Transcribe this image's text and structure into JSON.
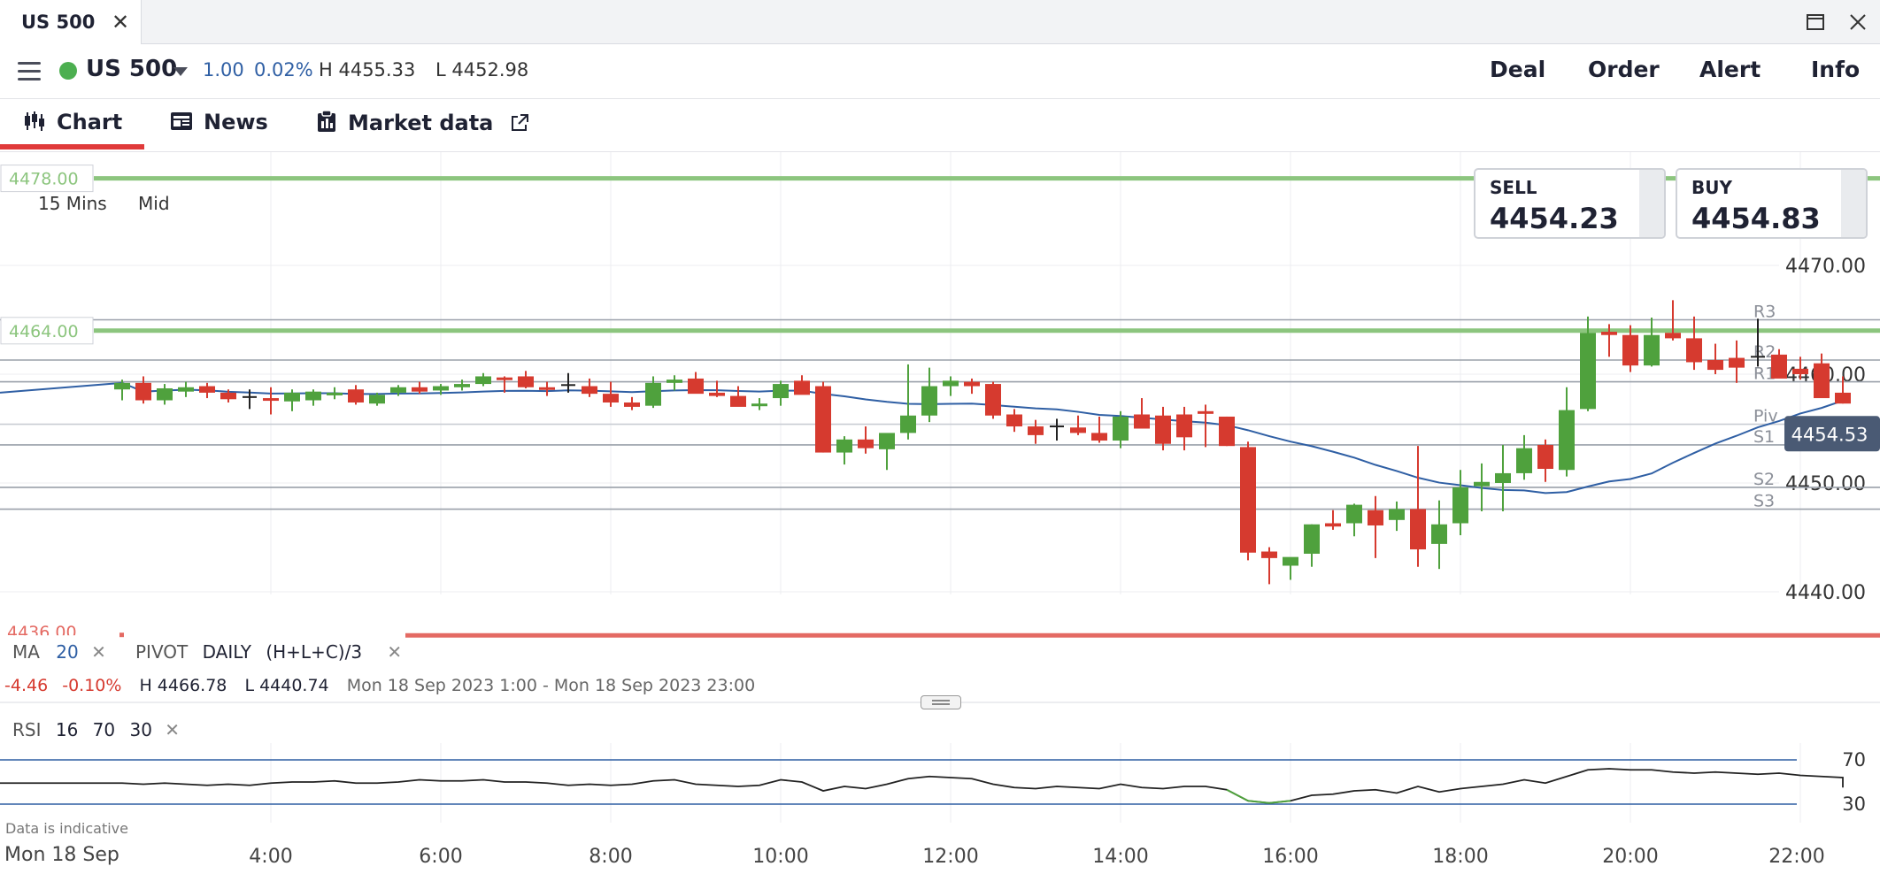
{
  "window": {
    "tab_title": "US 500",
    "close_icon": "close-icon",
    "maximize_icon": "maximize-icon"
  },
  "header": {
    "menu_icon": "hamburger-menu-icon",
    "status_color": "#4caf50",
    "instrument": "US 500",
    "change_points": "1.00",
    "change_pct": "0.02%",
    "high": "H 4455.33",
    "low": "L 4452.98",
    "actions": [
      "Deal",
      "Order",
      "Alert",
      "Info"
    ]
  },
  "subnav": {
    "tabs": [
      {
        "label": "Chart",
        "icon": "candlestick-icon",
        "active": true
      },
      {
        "label": "News",
        "icon": "newspaper-icon"
      },
      {
        "label": "Market data",
        "icon": "clipboard-icon",
        "external_icon": "external-link-icon"
      }
    ]
  },
  "quote": {
    "sell_label": "SELL",
    "sell_price": "4454.23",
    "buy_label": "BUY",
    "buy_price": "4454.83"
  },
  "timeframe": {
    "interval": "15 Mins",
    "price_type": "Mid"
  },
  "levels": {
    "alert_upper": "4478.00",
    "alert_mid": "4464.00",
    "alert_lower": "4436.00",
    "pivot_labels": [
      "R3",
      "R2",
      "R1",
      "Piv",
      "S1",
      "S2",
      "S3"
    ],
    "current_price_tag": "4454.53"
  },
  "indicators": {
    "ma_label": "MA",
    "ma_period": "20",
    "pivot_label": "PIVOT",
    "pivot_period": "DAILY",
    "pivot_formula": "(H+L+C)/3",
    "change_abs": "-4.46",
    "change_pct": "-0.10%",
    "session_high": "H 4466.78",
    "session_low": "L 4440.74",
    "session_range": "Mon 18 Sep 2023 1:00 - Mon 18 Sep 2023 23:00",
    "rsi_label": "RSI",
    "rsi_period": "16",
    "rsi_upper": "70",
    "rsi_lower": "30"
  },
  "footer": {
    "disclaimer": "Data is indicative",
    "date_label": "Mon 18 Sep"
  },
  "colors": {
    "up": "#4fa13d",
    "down": "#d63a2f",
    "accent_blue": "#2f5fa4",
    "alert_green": "#8cc57e",
    "alert_red": "#e46a63",
    "tag_bg": "#4a5a74"
  },
  "chart_data": {
    "type": "candlestick",
    "interval": "15 Mins",
    "y_range": [
      4436,
      4479
    ],
    "y_ticks": [
      "4470.00",
      "4460.00",
      "4450.00",
      "4440.00"
    ],
    "x_ticks": [
      "4:00",
      "6:00",
      "8:00",
      "10:00",
      "12:00",
      "14:00",
      "16:00",
      "18:00",
      "20:00",
      "22:00"
    ],
    "pivot_levels": {
      "R3": 4465.0,
      "R2": 4461.3,
      "R1": 4459.3,
      "Piv": 4455.4,
      "S1": 4453.5,
      "S2": 4449.6,
      "S3": 4447.6
    },
    "alert_lines": [
      4478.0,
      4464.0,
      4436.0
    ],
    "candles": [
      {
        "t": "2:15",
        "o": 4458.6,
        "h": 4459.5,
        "l": 4457.6,
        "c": 4459.2
      },
      {
        "t": "2:30",
        "o": 4459.2,
        "h": 4459.8,
        "l": 4457.3,
        "c": 4457.6
      },
      {
        "t": "2:45",
        "o": 4457.6,
        "h": 4459.1,
        "l": 4457.2,
        "c": 4458.7
      },
      {
        "t": "3:00",
        "o": 4458.4,
        "h": 4459.3,
        "l": 4457.9,
        "c": 4458.8
      },
      {
        "t": "3:15",
        "o": 4458.9,
        "h": 4459.2,
        "l": 4457.8,
        "c": 4458.3
      },
      {
        "t": "3:30",
        "o": 4458.3,
        "h": 4458.6,
        "l": 4457.4,
        "c": 4457.7
      },
      {
        "t": "3:45",
        "o": 4457.9,
        "h": 4458.6,
        "l": 4456.8,
        "c": 4457.9
      },
      {
        "t": "4:00",
        "o": 4457.8,
        "h": 4458.8,
        "l": 4456.3,
        "c": 4457.6
      },
      {
        "t": "4:15",
        "o": 4457.5,
        "h": 4458.6,
        "l": 4456.6,
        "c": 4458.3
      },
      {
        "t": "4:30",
        "o": 4457.6,
        "h": 4458.6,
        "l": 4457.1,
        "c": 4458.4
      },
      {
        "t": "4:45",
        "o": 4458.1,
        "h": 4458.8,
        "l": 4457.7,
        "c": 4458.3
      },
      {
        "t": "5:00",
        "o": 4458.6,
        "h": 4459.0,
        "l": 4457.2,
        "c": 4457.4
      },
      {
        "t": "5:15",
        "o": 4457.3,
        "h": 4458.3,
        "l": 4457.1,
        "c": 4458.1
      },
      {
        "t": "5:30",
        "o": 4458.3,
        "h": 4459.0,
        "l": 4458.0,
        "c": 4458.8
      },
      {
        "t": "5:45",
        "o": 4458.8,
        "h": 4459.3,
        "l": 4458.2,
        "c": 4458.4
      },
      {
        "t": "6:00",
        "o": 4458.5,
        "h": 4459.1,
        "l": 4458.1,
        "c": 4458.9
      },
      {
        "t": "6:15",
        "o": 4458.8,
        "h": 4459.5,
        "l": 4458.5,
        "c": 4459.1
      },
      {
        "t": "6:30",
        "o": 4459.1,
        "h": 4460.1,
        "l": 4458.9,
        "c": 4459.8
      },
      {
        "t": "6:45",
        "o": 4459.7,
        "h": 4459.8,
        "l": 4458.3,
        "c": 4459.5
      },
      {
        "t": "7:00",
        "o": 4459.8,
        "h": 4460.3,
        "l": 4458.7,
        "c": 4458.8
      },
      {
        "t": "7:15",
        "o": 4458.8,
        "h": 4459.3,
        "l": 4458.0,
        "c": 4458.6
      },
      {
        "t": "7:30",
        "o": 4459.0,
        "h": 4460.1,
        "l": 4458.3,
        "c": 4458.9
      },
      {
        "t": "7:45",
        "o": 4458.9,
        "h": 4459.6,
        "l": 4457.9,
        "c": 4458.2
      },
      {
        "t": "8:00",
        "o": 4458.2,
        "h": 4459.3,
        "l": 4457.0,
        "c": 4457.4
      },
      {
        "t": "8:15",
        "o": 4457.4,
        "h": 4457.9,
        "l": 4456.7,
        "c": 4457.0
      },
      {
        "t": "8:30",
        "o": 4457.1,
        "h": 4459.8,
        "l": 4456.9,
        "c": 4459.2
      },
      {
        "t": "8:45",
        "o": 4459.2,
        "h": 4459.9,
        "l": 4458.5,
        "c": 4459.5
      },
      {
        "t": "9:00",
        "o": 4459.6,
        "h": 4460.2,
        "l": 4458.6,
        "c": 4458.2
      },
      {
        "t": "9:15",
        "o": 4458.3,
        "h": 4459.4,
        "l": 4457.9,
        "c": 4458.0
      },
      {
        "t": "9:30",
        "o": 4458.0,
        "h": 4458.9,
        "l": 4457.6,
        "c": 4457.0
      },
      {
        "t": "9:45",
        "o": 4457.1,
        "h": 4457.8,
        "l": 4456.7,
        "c": 4457.3
      },
      {
        "t": "10:00",
        "o": 4457.8,
        "h": 4459.4,
        "l": 4457.1,
        "c": 4459.1
      },
      {
        "t": "10:15",
        "o": 4459.4,
        "h": 4459.9,
        "l": 4458.3,
        "c": 4458.1
      },
      {
        "t": "10:30",
        "o": 4458.9,
        "h": 4459.3,
        "l": 4452.8,
        "c": 4452.8
      },
      {
        "t": "10:45",
        "o": 4452.8,
        "h": 4454.3,
        "l": 4451.7,
        "c": 4454.0
      },
      {
        "t": "11:00",
        "o": 4454.0,
        "h": 4455.2,
        "l": 4452.7,
        "c": 4453.2
      },
      {
        "t": "11:15",
        "o": 4453.1,
        "h": 4454.5,
        "l": 4451.2,
        "c": 4454.6
      },
      {
        "t": "11:30",
        "o": 4454.6,
        "h": 4460.9,
        "l": 4454.0,
        "c": 4456.2
      },
      {
        "t": "11:45",
        "o": 4456.2,
        "h": 4460.6,
        "l": 4455.6,
        "c": 4458.9
      },
      {
        "t": "12:00",
        "o": 4458.9,
        "h": 4459.8,
        "l": 4458.0,
        "c": 4459.4
      },
      {
        "t": "12:15",
        "o": 4459.3,
        "h": 4459.6,
        "l": 4458.2,
        "c": 4458.9
      },
      {
        "t": "12:30",
        "o": 4459.1,
        "h": 4459.3,
        "l": 4455.9,
        "c": 4456.2
      },
      {
        "t": "12:45",
        "o": 4456.3,
        "h": 4456.8,
        "l": 4454.7,
        "c": 4455.2
      },
      {
        "t": "13:00",
        "o": 4455.2,
        "h": 4455.8,
        "l": 4453.6,
        "c": 4454.4
      },
      {
        "t": "13:15",
        "o": 4455.1,
        "h": 4455.9,
        "l": 4453.9,
        "c": 4455.2
      },
      {
        "t": "13:30",
        "o": 4455.1,
        "h": 4456.2,
        "l": 4454.4,
        "c": 4454.6
      },
      {
        "t": "13:45",
        "o": 4454.6,
        "h": 4456.1,
        "l": 4453.7,
        "c": 4453.9
      },
      {
        "t": "14:00",
        "o": 4453.9,
        "h": 4456.6,
        "l": 4453.2,
        "c": 4456.1
      },
      {
        "t": "14:15",
        "o": 4456.3,
        "h": 4457.8,
        "l": 4455.5,
        "c": 4455.0
      },
      {
        "t": "14:30",
        "o": 4456.2,
        "h": 4457.0,
        "l": 4453.0,
        "c": 4453.6
      },
      {
        "t": "14:45",
        "o": 4456.3,
        "h": 4457.0,
        "l": 4453.0,
        "c": 4454.2
      },
      {
        "t": "15:00",
        "o": 4456.6,
        "h": 4457.2,
        "l": 4453.3,
        "c": 4456.4
      },
      {
        "t": "15:15",
        "o": 4456.1,
        "h": 4456.1,
        "l": 4453.4,
        "c": 4453.4
      },
      {
        "t": "15:30",
        "o": 4453.3,
        "h": 4453.8,
        "l": 4442.9,
        "c": 4443.6
      },
      {
        "t": "15:45",
        "o": 4443.7,
        "h": 4444.1,
        "l": 4440.7,
        "c": 4443.1
      },
      {
        "t": "16:00",
        "o": 4442.4,
        "h": 4443.1,
        "l": 4441.1,
        "c": 4443.2
      },
      {
        "t": "16:15",
        "o": 4443.5,
        "h": 4446.2,
        "l": 4442.3,
        "c": 4446.2
      },
      {
        "t": "16:30",
        "o": 4446.3,
        "h": 4447.5,
        "l": 4445.7,
        "c": 4446.0
      },
      {
        "t": "16:45",
        "o": 4446.3,
        "h": 4448.1,
        "l": 4445.1,
        "c": 4448.0
      },
      {
        "t": "17:00",
        "o": 4447.5,
        "h": 4448.8,
        "l": 4443.1,
        "c": 4446.1
      },
      {
        "t": "17:15",
        "o": 4446.6,
        "h": 4448.3,
        "l": 4445.6,
        "c": 4447.6
      },
      {
        "t": "17:30",
        "o": 4447.6,
        "h": 4453.4,
        "l": 4442.3,
        "c": 4443.9
      },
      {
        "t": "17:45",
        "o": 4444.4,
        "h": 4448.4,
        "l": 4442.1,
        "c": 4446.2
      },
      {
        "t": "18:00",
        "o": 4446.3,
        "h": 4451.2,
        "l": 4445.2,
        "c": 4449.6
      },
      {
        "t": "18:15",
        "o": 4449.7,
        "h": 4451.8,
        "l": 4447.4,
        "c": 4450.1
      },
      {
        "t": "18:30",
        "o": 4450.0,
        "h": 4453.5,
        "l": 4447.4,
        "c": 4450.9
      },
      {
        "t": "18:45",
        "o": 4450.9,
        "h": 4454.4,
        "l": 4450.3,
        "c": 4453.2
      },
      {
        "t": "19:00",
        "o": 4453.5,
        "h": 4454.0,
        "l": 4450.1,
        "c": 4451.3
      },
      {
        "t": "19:15",
        "o": 4451.2,
        "h": 4458.8,
        "l": 4450.6,
        "c": 4456.7
      },
      {
        "t": "19:30",
        "o": 4456.8,
        "h": 4465.3,
        "l": 4456.6,
        "c": 4463.8
      },
      {
        "t": "19:45",
        "o": 4463.9,
        "h": 4464.6,
        "l": 4461.6,
        "c": 4463.6
      },
      {
        "t": "20:00",
        "o": 4463.6,
        "h": 4464.5,
        "l": 4460.2,
        "c": 4460.8
      },
      {
        "t": "20:15",
        "o": 4460.8,
        "h": 4465.2,
        "l": 4460.7,
        "c": 4463.6
      },
      {
        "t": "20:30",
        "o": 4463.8,
        "h": 4466.8,
        "l": 4463.1,
        "c": 4463.3
      },
      {
        "t": "20:45",
        "o": 4463.3,
        "h": 4465.3,
        "l": 4460.4,
        "c": 4461.1
      },
      {
        "t": "21:00",
        "o": 4461.3,
        "h": 4462.8,
        "l": 4460.0,
        "c": 4460.4
      },
      {
        "t": "21:15",
        "o": 4461.5,
        "h": 4463.1,
        "l": 4459.2,
        "c": 4460.6
      },
      {
        "t": "21:30",
        "o": 4461.6,
        "h": 4465.1,
        "l": 4460.7,
        "c": 4461.5
      },
      {
        "t": "21:45",
        "o": 4461.8,
        "h": 4462.3,
        "l": 4459.9,
        "c": 4459.6
      },
      {
        "t": "22:00",
        "o": 4460.5,
        "h": 4461.6,
        "l": 4459.5,
        "c": 4460.0
      },
      {
        "t": "22:15",
        "o": 4461.0,
        "h": 4461.9,
        "l": 4458.9,
        "c": 4457.8
      },
      {
        "t": "22:30",
        "o": 4458.3,
        "h": 4459.8,
        "l": 4457.3,
        "c": 4457.3
      }
    ],
    "rsi": [
      49,
      48,
      49,
      48,
      47,
      48,
      47,
      49,
      50,
      50,
      51,
      49,
      49,
      50,
      52,
      51,
      51,
      52,
      50,
      50,
      49,
      47,
      48,
      47,
      48,
      51,
      52,
      48,
      47,
      46,
      47,
      52,
      50,
      42,
      46,
      44,
      48,
      53,
      55,
      54,
      53,
      48,
      45,
      44,
      46,
      45,
      44,
      48,
      45,
      44,
      46,
      46,
      43,
      33,
      31,
      33,
      38,
      39,
      42,
      43,
      40,
      46,
      41,
      44,
      46,
      48,
      52,
      49,
      55,
      61,
      62,
      61,
      61,
      59,
      58,
      59,
      58,
      57,
      58,
      56,
      55,
      54,
      47,
      49,
      48,
      45,
      47,
      50
    ]
  }
}
